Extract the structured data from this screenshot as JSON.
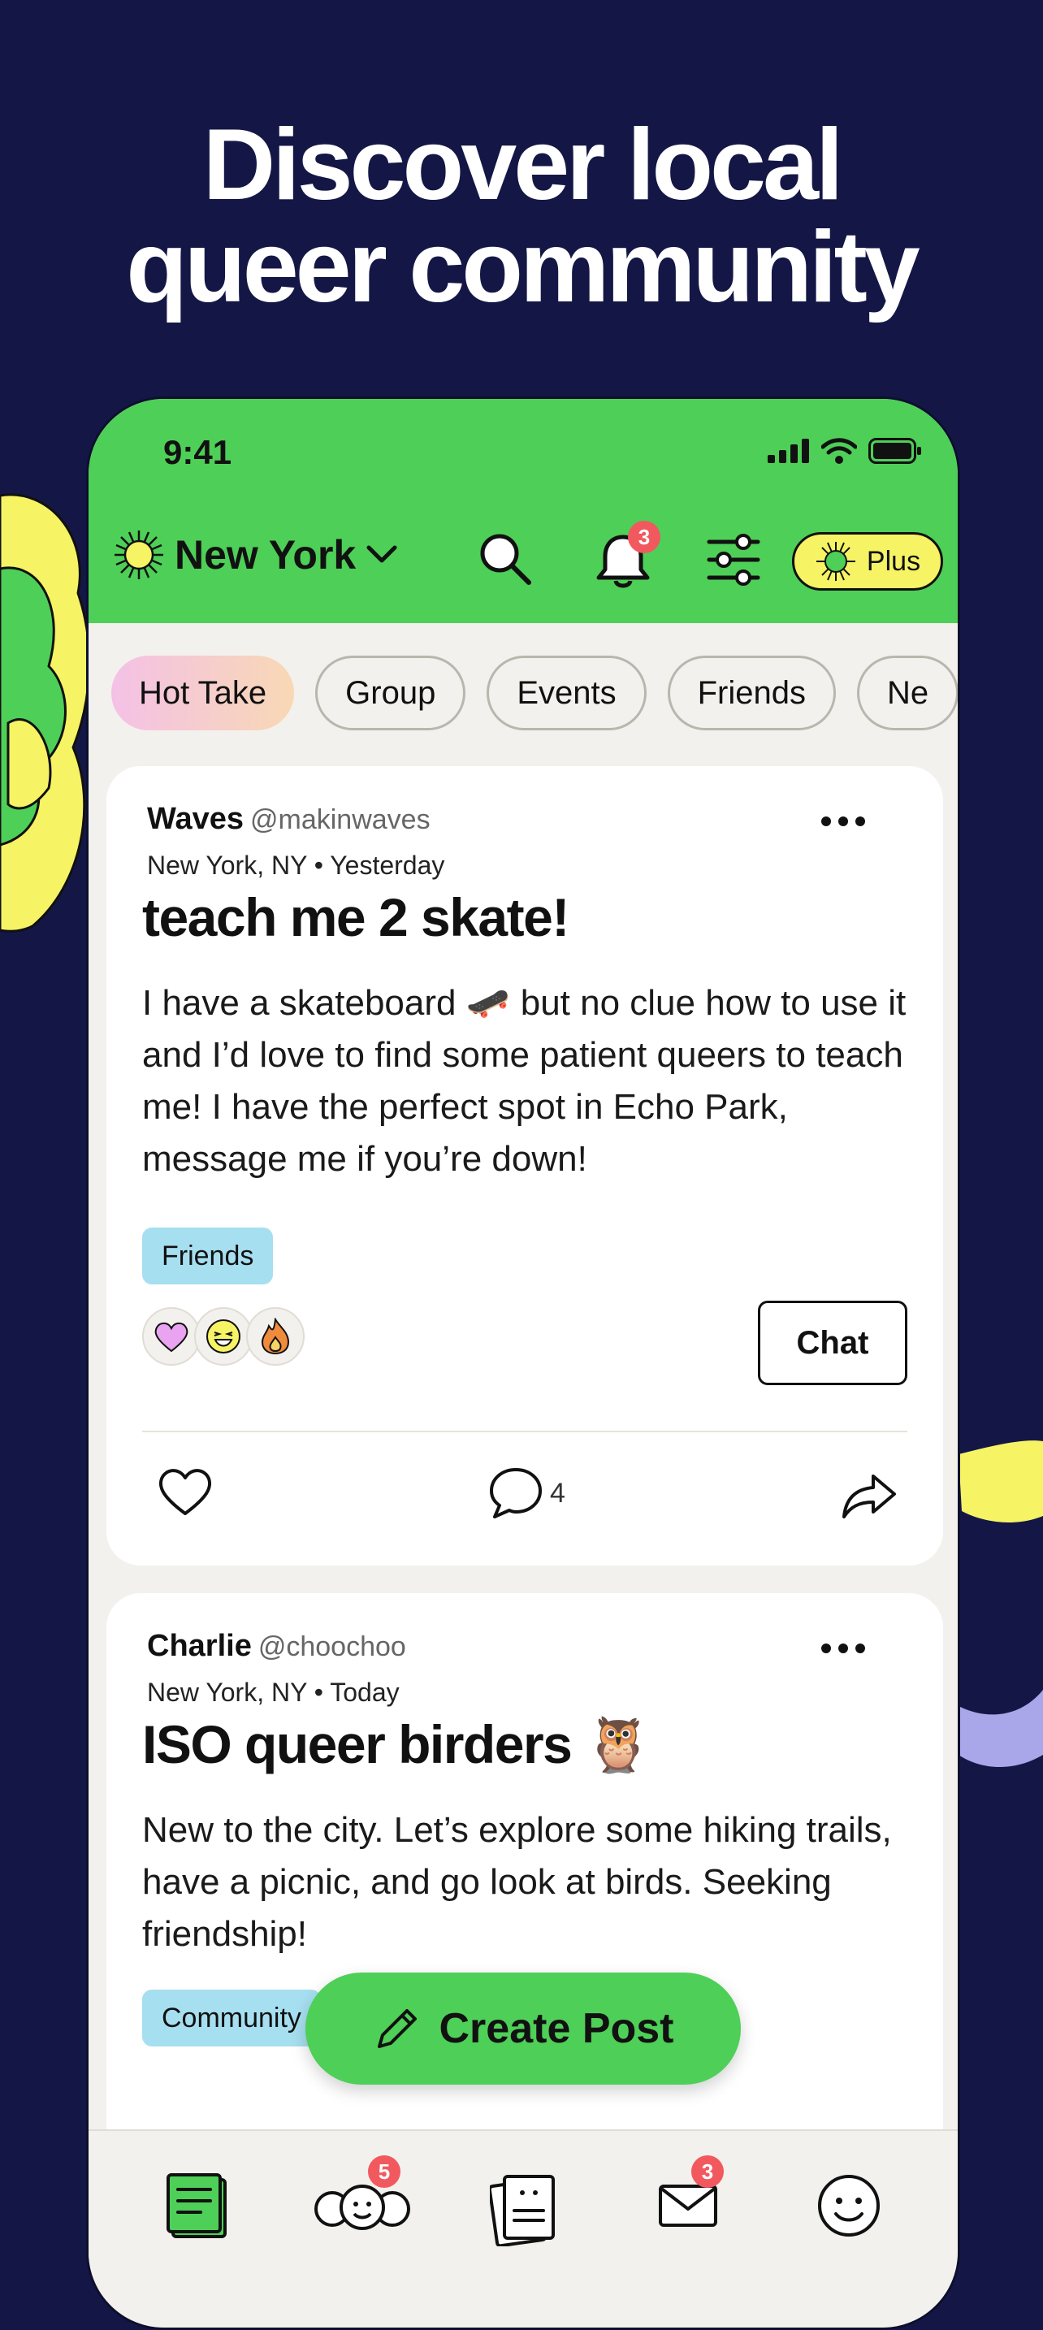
{
  "headline": {
    "line1": "Discover local",
    "line2": "queer community"
  },
  "status_bar": {
    "time": "9:41"
  },
  "header": {
    "location": "New York",
    "notifications_badge": "3",
    "plus_label": "Plus"
  },
  "chips": [
    "Hot Take",
    "Group",
    "Events",
    "Friends",
    "Ne"
  ],
  "posts": [
    {
      "author": "Waves",
      "handle": "@makinwaves",
      "meta": "New York, NY • Yesterday",
      "title": "teach me 2 skate!",
      "body": "I have a skateboard 🛹 but no clue how to use it and I’d love to find some patient queers to teach me! I have the perfect spot in Echo Park, message me if you’re down!",
      "tag": "Friends",
      "reactions": [
        "purple-heart",
        "laughing-face",
        "fire"
      ],
      "chat_label": "Chat",
      "comment_count": "4"
    },
    {
      "author": "Charlie",
      "handle": "@choochoo",
      "meta": "New York, NY • Today",
      "title": "ISO queer birders 🦉",
      "body": "New to the city. Let’s explore some hiking trails, have a picnic, and go look at birds. Seeking friendship!",
      "tag": "Community"
    }
  ],
  "create_post_label": "Create Post",
  "tabbar": {
    "community_badge": "5",
    "messages_badge": "3"
  },
  "colors": {
    "background": "#141745",
    "brand_green": "#4ecf57",
    "plus_yellow": "#f6f365",
    "badge_red": "#f1595f",
    "tag_blue": "#a6dff0"
  }
}
